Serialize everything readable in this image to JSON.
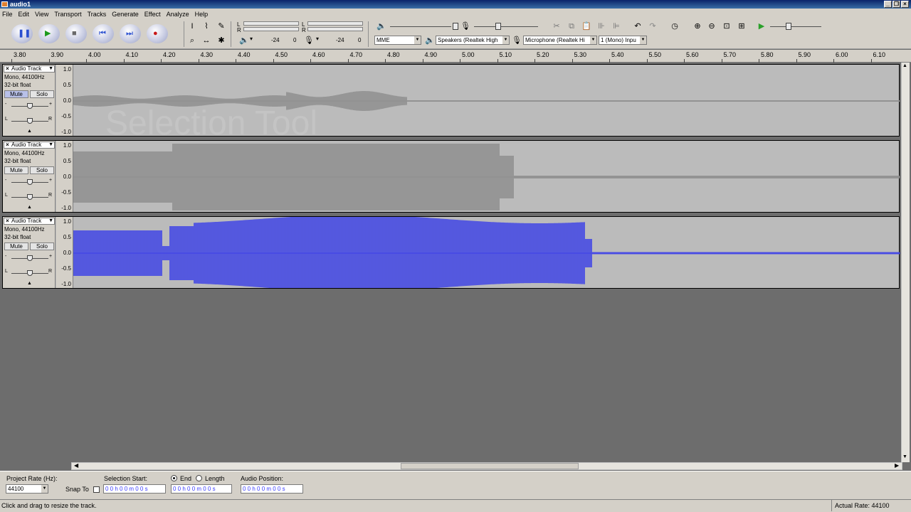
{
  "window": {
    "title": "audio1"
  },
  "menu": [
    "File",
    "Edit",
    "View",
    "Transport",
    "Tracks",
    "Generate",
    "Effect",
    "Analyze",
    "Help"
  ],
  "colors": {
    "accent": "#3a3cff",
    "track_bg": "#bbbbbb",
    "wave_gray": "#8d8d8d",
    "wave_blue": "#3b3fe8"
  },
  "transport_buttons": [
    {
      "name": "pause-button",
      "icon": "pause-icon",
      "glyph": "❚❚"
    },
    {
      "name": "play-button",
      "icon": "play-icon",
      "glyph": "▶"
    },
    {
      "name": "stop-button",
      "icon": "stop-icon",
      "glyph": "■"
    },
    {
      "name": "skip-start-button",
      "icon": "skip-start-icon",
      "glyph": "⏮"
    },
    {
      "name": "skip-end-button",
      "icon": "skip-end-icon",
      "glyph": "⏭"
    },
    {
      "name": "record-button",
      "icon": "record-icon",
      "glyph": "●"
    }
  ],
  "meters": {
    "out_l": "L",
    "out_r": "R",
    "in_l": "L",
    "in_r": "R",
    "db1": "-24",
    "db2": "0",
    "db3": "-24",
    "db4": "0"
  },
  "devices": {
    "host": "MME",
    "output": "Speakers (Realtek High",
    "input": "Microphone (Realtek Hi",
    "channels": "1 (Mono) Inpu"
  },
  "ruler": [
    "3.80",
    "3.90",
    "4.00",
    "4.10",
    "4.20",
    "4.30",
    "4.40",
    "4.50",
    "4.60",
    "4.70",
    "4.80",
    "4.90",
    "5.00",
    "5.10",
    "5.20",
    "5.30",
    "5.40",
    "5.50",
    "5.60",
    "5.70",
    "5.80",
    "5.90",
    "6.00",
    "6.10"
  ],
  "tracks": [
    {
      "name": "Audio Track",
      "format": "Mono, 44100Hz",
      "depth": "32-bit float",
      "mute": "Mute",
      "solo": "Solo",
      "color": "gray",
      "level": "0.5"
    },
    {
      "name": "Audio Track",
      "format": "Mono, 44100Hz",
      "depth": "32-bit float",
      "mute": "Mute",
      "solo": "Solo",
      "color": "gray",
      "level": "1.0"
    },
    {
      "name": "Audio Track",
      "format": "Mono, 44100Hz",
      "depth": "32-bit float",
      "mute": "Mute",
      "solo": "Solo",
      "color": "blue",
      "level": "1.0"
    }
  ],
  "scale_labels": [
    "1.0",
    "0.5",
    "0.0",
    "-0.5",
    "-1.0"
  ],
  "pan_l": "L",
  "pan_r": "R",
  "watermark": "Selection Tool",
  "selection": {
    "project_rate_label": "Project Rate (Hz):",
    "project_rate": "44100",
    "snap_label": "Snap To",
    "start_label": "Selection Start:",
    "end_label": "End",
    "length_label": "Length",
    "audio_pos_label": "Audio Position:",
    "start_value": "0 0 h 0 0 m 0 0 s",
    "end_value": "0 0 h 0 0 m 0 0 s",
    "pos_value": "0 0 h 0 0 m 0 0 s"
  },
  "status": {
    "message": "Click and drag to resize the track.",
    "rate": "Actual Rate: 44100"
  }
}
